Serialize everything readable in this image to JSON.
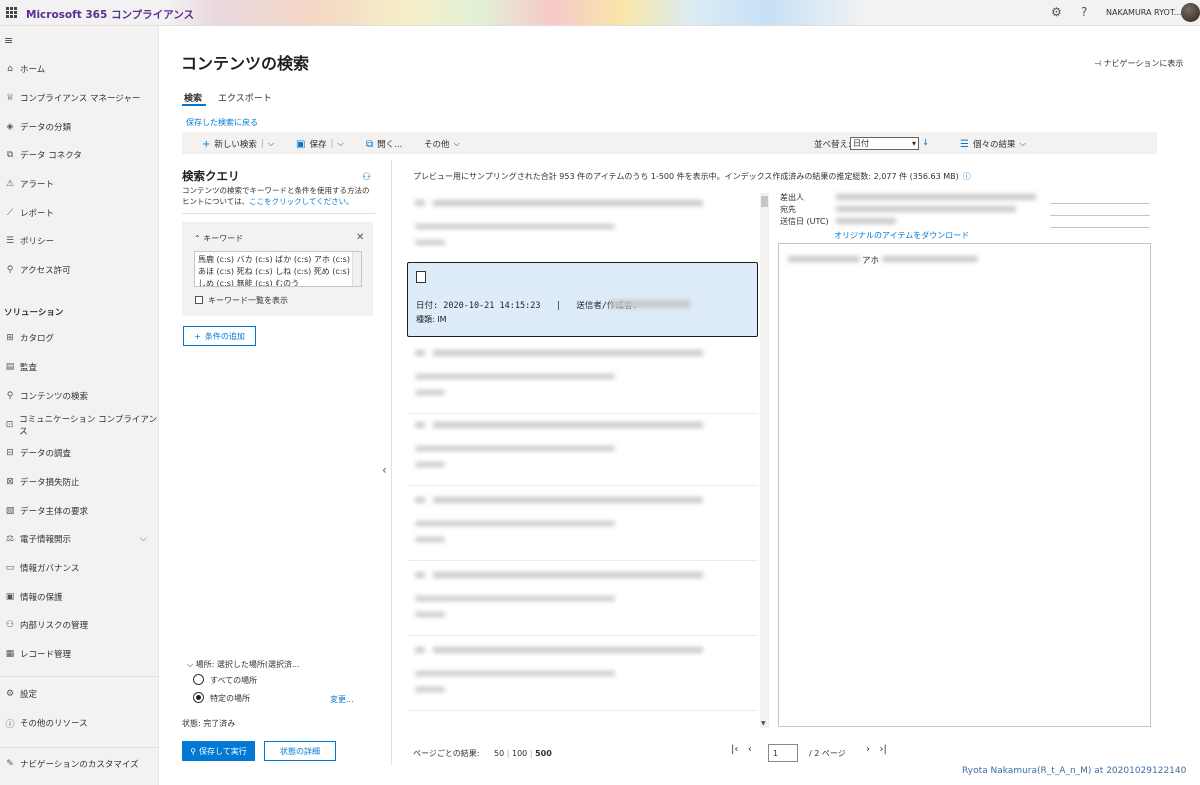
{
  "topbar": {
    "app_title": "Microsoft 365 コンプライアンス",
    "user_name": "NAKAMURA RYOT...",
    "icons": [
      "waffle-icon",
      "gear-icon",
      "help-icon"
    ]
  },
  "leftnav": {
    "items": [
      {
        "label": "ホーム",
        "icon": "⌂"
      },
      {
        "label": "コンプライアンス マネージャー",
        "icon": "♕"
      },
      {
        "label": "データの分類",
        "icon": "◈"
      },
      {
        "label": "データ コネクタ",
        "icon": "⧉"
      },
      {
        "label": "アラート",
        "icon": "⚠"
      },
      {
        "label": "レポート",
        "icon": "⟋"
      },
      {
        "label": "ポリシー",
        "icon": "☰"
      },
      {
        "label": "アクセス許可",
        "icon": "⚲"
      }
    ],
    "section_label": "ソリューション",
    "solutions": [
      {
        "label": "カタログ",
        "icon": "⊞"
      },
      {
        "label": "監査",
        "icon": "▤"
      },
      {
        "label": "コンテンツの検索",
        "icon": "⚲"
      },
      {
        "label": "コミュニケーション コンプライアンス",
        "icon": "⊡"
      },
      {
        "label": "データの調査",
        "icon": "⊟"
      },
      {
        "label": "データ損失防止",
        "icon": "⊠"
      },
      {
        "label": "データ主体の要求",
        "icon": "▧"
      },
      {
        "label": "電子情報開示",
        "icon": "⚖"
      },
      {
        "label": "情報ガバナンス",
        "icon": "▭"
      },
      {
        "label": "情報の保護",
        "icon": "▣"
      },
      {
        "label": "内部リスクの管理",
        "icon": "⚇"
      },
      {
        "label": "レコード管理",
        "icon": "▦"
      }
    ],
    "bottom": [
      {
        "label": "設定",
        "icon": "⚙"
      },
      {
        "label": "その他のリソース",
        "icon": "ⓘ"
      },
      {
        "label": "ナビゲーションのカスタマイズ",
        "icon": "✎"
      }
    ]
  },
  "main": {
    "title": "コンテンツの検索",
    "nav_toggle": "ナビゲーションに表示",
    "tabs": [
      "検索",
      "エクスポート"
    ],
    "saved_link": "保存した検索に戻る",
    "toolbar": {
      "new_search": "新しい検索",
      "save": "保存",
      "open": "開く...",
      "more": "その他",
      "sort_label": "並べ替え:",
      "sort_value": "日付",
      "view": "個々の結果"
    }
  },
  "query": {
    "title": "検索クエリ",
    "desc_prefix": "コンテンツの検索でキーワードと条件を使用する方法のヒントについては、",
    "desc_link": "ここをクリックしてください。",
    "keyword_label": "キーワード",
    "keywords_text": "馬鹿 (c:s) バカ (c:s) ばか (c:s) アホ (c:s) あほ (c:s) 死ね (c:s) しね (c:s) 死め (c:s) しめ (c:s) 無能 (c:s) むのう",
    "keyword_list_label": "キーワード一覧を表示",
    "add_condition": "条件の追加",
    "location_header": "場所: 選択した場所(選択済...",
    "location_all": "すべての場所",
    "location_specific": "特定の場所",
    "location_change": "変更...",
    "status": "状態: 完了済み",
    "save_run": "保存して実行",
    "status_detail": "状態の詳細"
  },
  "results": {
    "summary": "プレビュー用にサンプリングされた合計 953 件のアイテムのうち 1-500 件を表示中。インデックス作成済みの結果の推定総数: 2,077 件 (356.63 MB)",
    "selected": {
      "date_label": "日付: 2020-10-21 14:15:23",
      "sep": "|",
      "sender_label": "送信者/作成者:",
      "type": "種類: IM"
    },
    "per_page_label": "ページごとの結果:",
    "per_page_options": [
      "50",
      "100",
      "500"
    ],
    "page_current": "1",
    "page_of": "/ 2 ページ"
  },
  "preview": {
    "from_label": "差出人",
    "to_label": "宛先",
    "sent_label": "送信日 (UTC)",
    "download": "オリジナルのアイテムをダウンロード",
    "body_word": "アホ"
  },
  "watermark": "Ryota Nakamura(R_t_A_n_M) at 20201029122140"
}
